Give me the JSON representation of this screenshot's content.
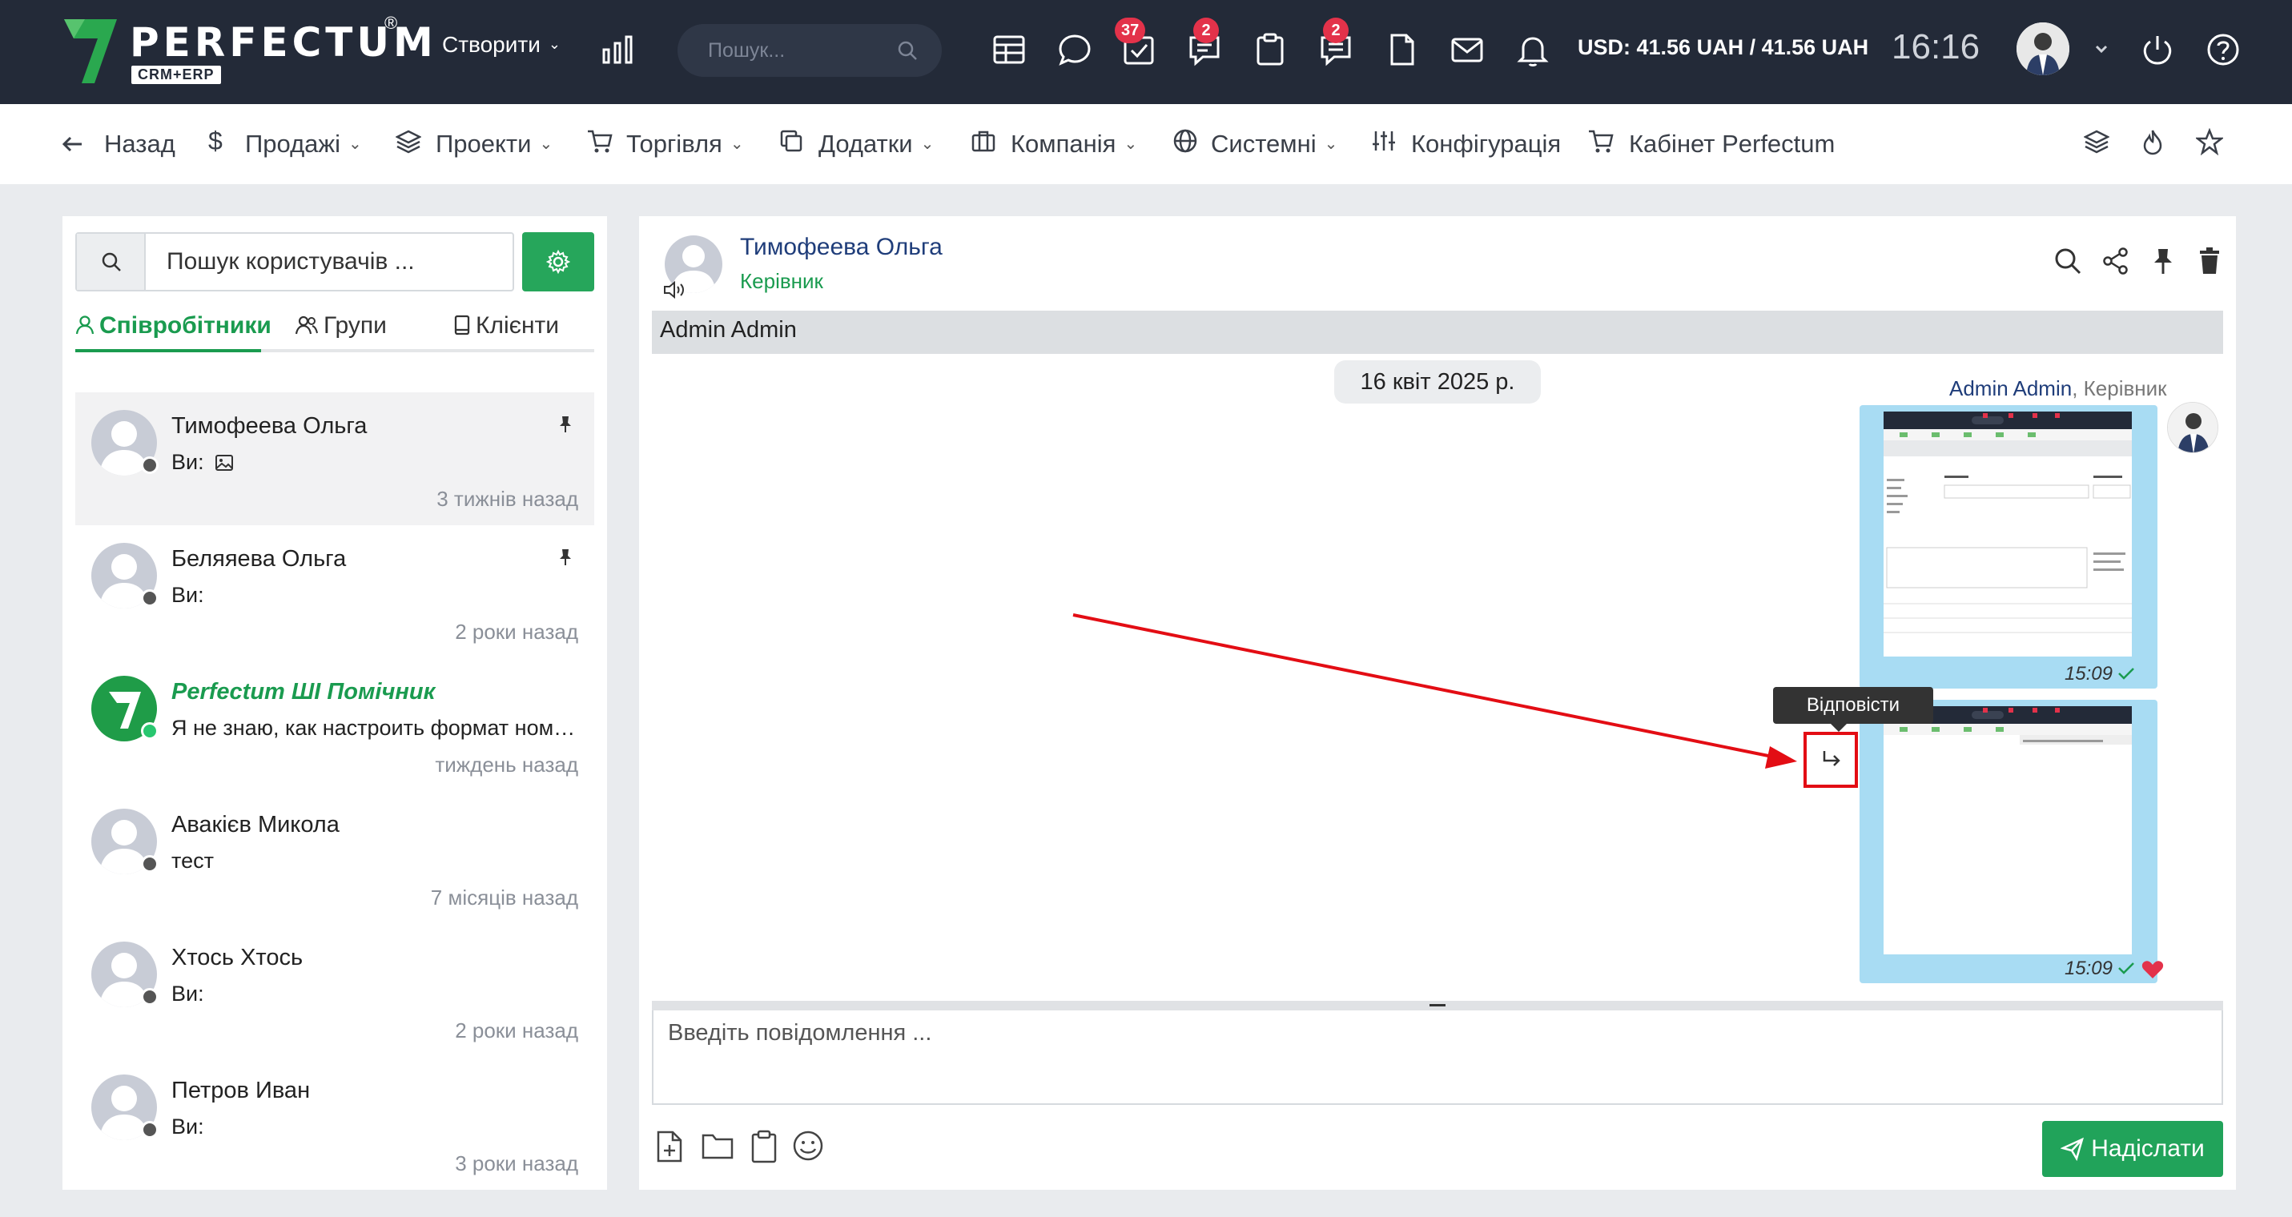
{
  "topbar": {
    "logo_text": "PERFECTUM",
    "logo_reg": "®",
    "logo_sub": "CRM+ERP",
    "create_label": "Створити",
    "search_placeholder": "Пошук...",
    "badges": {
      "tasks": "37",
      "chat": "2",
      "notes": "2"
    },
    "currency": "USD: 41.56 UAH / 41.56 UAH",
    "time": "16:16"
  },
  "nav": {
    "back": "Назад",
    "sales": "Продажі",
    "projects": "Проекти",
    "trade": "Торгівля",
    "addons": "Додатки",
    "company": "Компанія",
    "system": "Системні",
    "config": "Конфігурація",
    "cabinet": "Кабінет Perfectum"
  },
  "sidebar": {
    "search_placeholder": "Пошук користувачів ...",
    "tabs": [
      "Співробітники",
      "Групи",
      "Клієнти"
    ],
    "contacts": [
      {
        "name": "Тимофеева Ольга",
        "preview": "Ви:",
        "time": "3 тижнів назад",
        "pinned": true,
        "status": "offline"
      },
      {
        "name": "Беляяева Ольга",
        "preview": "Ви:",
        "time": "2 роки назад",
        "pinned": true,
        "status": "offline"
      },
      {
        "name": "Perfectum ШІ Помічник",
        "preview": "Я не знаю, как настроить формат номера",
        "time": "тиждень назад",
        "pinned": false,
        "status": "online"
      },
      {
        "name": "Авакієв Микола",
        "preview": "тест",
        "time": "7 місяців назад",
        "pinned": false,
        "status": "offline"
      },
      {
        "name": "Хтось Хтось",
        "preview": "Ви:",
        "time": "2 роки назад",
        "pinned": false,
        "status": "offline"
      },
      {
        "name": "Петров Иван",
        "preview": "Ви:",
        "time": "3 роки назад",
        "pinned": false,
        "status": "offline"
      }
    ]
  },
  "chat": {
    "contact_name": "Тимофеева Ольга",
    "contact_role": "Керівник",
    "thread_title": "Admin Admin",
    "date": "16 квіт 2025 р.",
    "author_name": "Admin Admin",
    "author_role": ", Керівник",
    "messages": [
      {
        "time": "15:09"
      },
      {
        "time": "15:09"
      }
    ],
    "reply_tooltip": "Відповісти",
    "composer_placeholder": "Введіть повідомлення ...",
    "send_label": "Надіслати"
  },
  "colors": {
    "topbar": "#232a38",
    "accent_green": "#26a65b",
    "badge_red": "#e3324a",
    "bubble": "#a8dcf3",
    "annotation_red": "#e30d14"
  }
}
